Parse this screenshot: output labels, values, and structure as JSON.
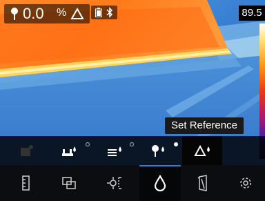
{
  "status": {
    "reading_value": "0.0",
    "reading_unit": "%",
    "probe_icon": "probe-icon",
    "delta_icon": "delta-icon",
    "battery_icon": "battery-icon",
    "bluetooth_icon": "bluetooth-icon"
  },
  "scale": {
    "max_value": "89.5"
  },
  "tooltip": {
    "text": "Set Reference"
  },
  "mode_toolbar": {
    "items": [
      {
        "icon": "mode-disabled-icon",
        "enabled": false
      },
      {
        "icon": "surface-moisture-icon",
        "indicator": "off"
      },
      {
        "icon": "layered-moisture-icon",
        "indicator": "off"
      },
      {
        "icon": "pin-moisture-icon",
        "indicator": "on"
      },
      {
        "icon": "delta-reference-icon",
        "active": true
      }
    ]
  },
  "main_nav": {
    "items": [
      {
        "icon": "scale-adjust-icon"
      },
      {
        "icon": "image-blend-icon"
      },
      {
        "icon": "measurement-spot-icon"
      },
      {
        "icon": "moisture-drop-icon",
        "active": true
      },
      {
        "icon": "emissivity-icon"
      },
      {
        "icon": "settings-gear-icon"
      }
    ]
  },
  "colors": {
    "accent": "#3a78c8",
    "toolbar_bg": "#000000",
    "hot": "#ff7a1a",
    "cold": "#2f6fc6"
  }
}
